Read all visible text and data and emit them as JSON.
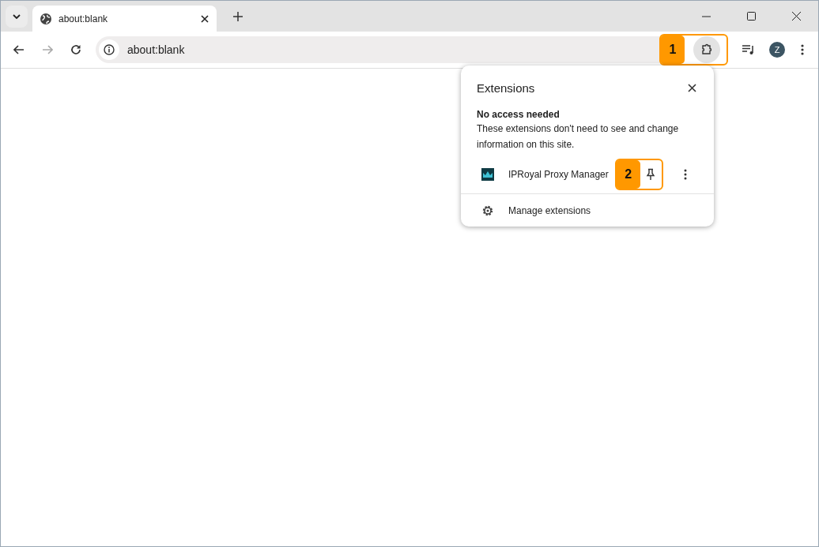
{
  "tab": {
    "title": "about:blank",
    "selected": true
  },
  "address_bar": {
    "url": "about:blank"
  },
  "profile": {
    "initial": "Z"
  },
  "callouts": [
    {
      "label": "1"
    },
    {
      "label": "2"
    }
  ],
  "extensions_popup": {
    "title": "Extensions",
    "section_heading": "No access needed",
    "section_text": "These extensions don't need to see and change information on this site.",
    "extensions": [
      {
        "name": "IPRoyal Proxy Manager"
      }
    ],
    "footer_link": "Manage extensions"
  }
}
